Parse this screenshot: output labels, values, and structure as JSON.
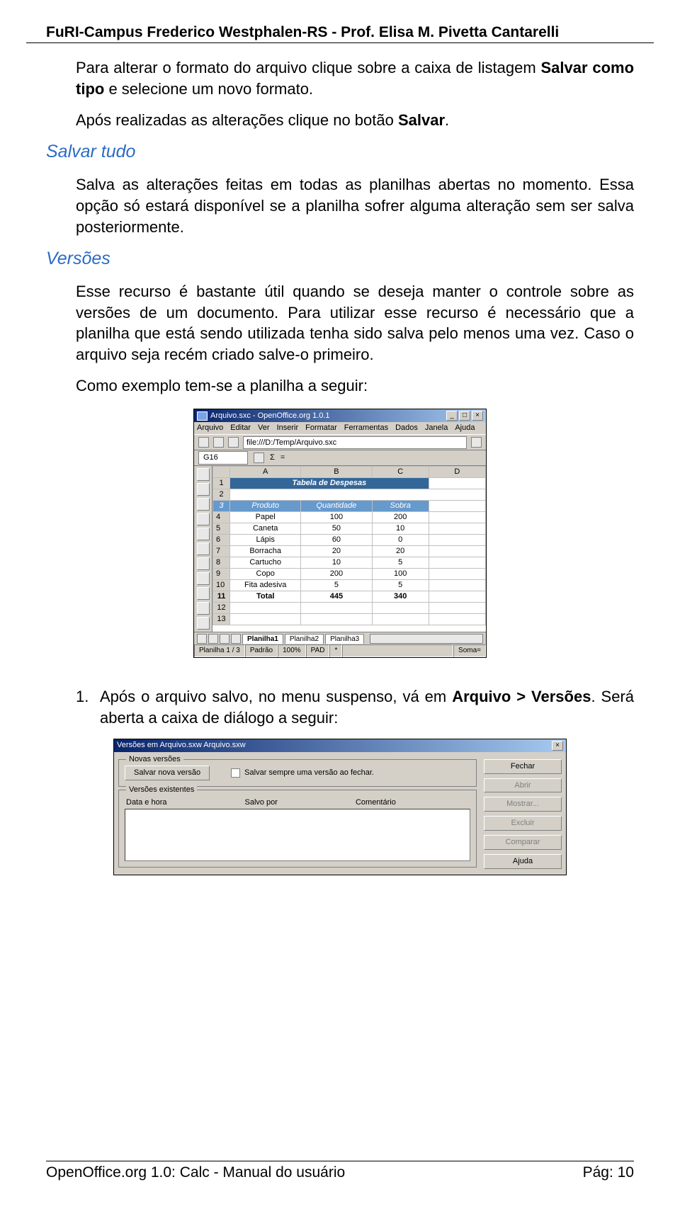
{
  "header": "FuRI-Campus Frederico Westphalen-RS   -   Prof. Elisa M. Pivetta Cantarelli",
  "paras": {
    "p1a": "Para alterar o formato do arquivo clique sobre a caixa de listagem ",
    "p1b": "Salvar como tipo",
    "p1c": " e selecione um novo formato.",
    "p2a": "Após realizadas as alterações clique no botão ",
    "p2b": "Salvar",
    "p2c": "."
  },
  "sec1": {
    "title": "Salvar tudo",
    "text": "Salva as alterações feitas em todas as planilhas abertas no momento. Essa opção só estará disponível se a planilha sofrer alguma alteração sem ser salva posteriormente."
  },
  "sec2": {
    "title": "Versões",
    "p1": "Esse recurso é bastante útil quando se deseja manter o controle sobre as versões de um documento. Para utilizar esse recurso é necessário que a planilha que está sendo utilizada tenha sido salva pelo menos uma vez. Caso o arquivo seja recém criado salve-o primeiro.",
    "p2": "Como exemplo tem-se a planilha a seguir:"
  },
  "ss1": {
    "title": "Arquivo.sxc - OpenOffice.org 1.0.1",
    "menu": [
      "Arquivo",
      "Editar",
      "Ver",
      "Inserir",
      "Formatar",
      "Ferramentas",
      "Dados",
      "Janela",
      "Ajuda"
    ],
    "url": "file:///D:/Temp/Arquivo.sxc",
    "cellref": "G16",
    "colhead": [
      "",
      "A",
      "B",
      "C",
      "D"
    ],
    "title_row": "Tabela de Despesas",
    "header_row": [
      "Produto",
      "Quantidade",
      "Sobra"
    ],
    "rows": [
      [
        "Papel",
        "100",
        "200"
      ],
      [
        "Caneta",
        "50",
        "10"
      ],
      [
        "Lápis",
        "60",
        "0"
      ],
      [
        "Borracha",
        "20",
        "20"
      ],
      [
        "Cartucho",
        "10",
        "5"
      ],
      [
        "Copo",
        "200",
        "100"
      ],
      [
        "Fita adesiva",
        "5",
        "5"
      ]
    ],
    "total": [
      "Total",
      "445",
      "340"
    ],
    "tabs": [
      "Planilha1",
      "Planilha2",
      "Planilha3"
    ],
    "status": {
      "sheet": "Planilha 1 / 3",
      "std": "Padrão",
      "zoom": "100%",
      "pad": "PAD",
      "star": "*",
      "sum": "Soma="
    }
  },
  "listitem": {
    "num": "1.",
    "a": "Após o arquivo salvo, no menu suspenso, vá em ",
    "b": "Arquivo > Versões",
    "c": ". Será aberta a caixa de diálogo a seguir:"
  },
  "dlg": {
    "title": "Versões em Arquivo.sxw Arquivo.sxw",
    "grp1": "Novas versões",
    "save_btn": "Salvar nova versão",
    "chk_label": "Salvar sempre uma versão ao fechar.",
    "grp2": "Versões existentes",
    "cols": [
      "Data e hora",
      "Salvo por",
      "Comentário"
    ],
    "btns": {
      "close": "Fechar",
      "open": "Abrir",
      "show": "Mostrar...",
      "del": "Excluir",
      "comp": "Comparar",
      "help": "Ajuda"
    }
  },
  "footer": {
    "left": "OpenOffice.org 1.0: Calc - Manual do usuário",
    "right": "Pág: 10"
  }
}
